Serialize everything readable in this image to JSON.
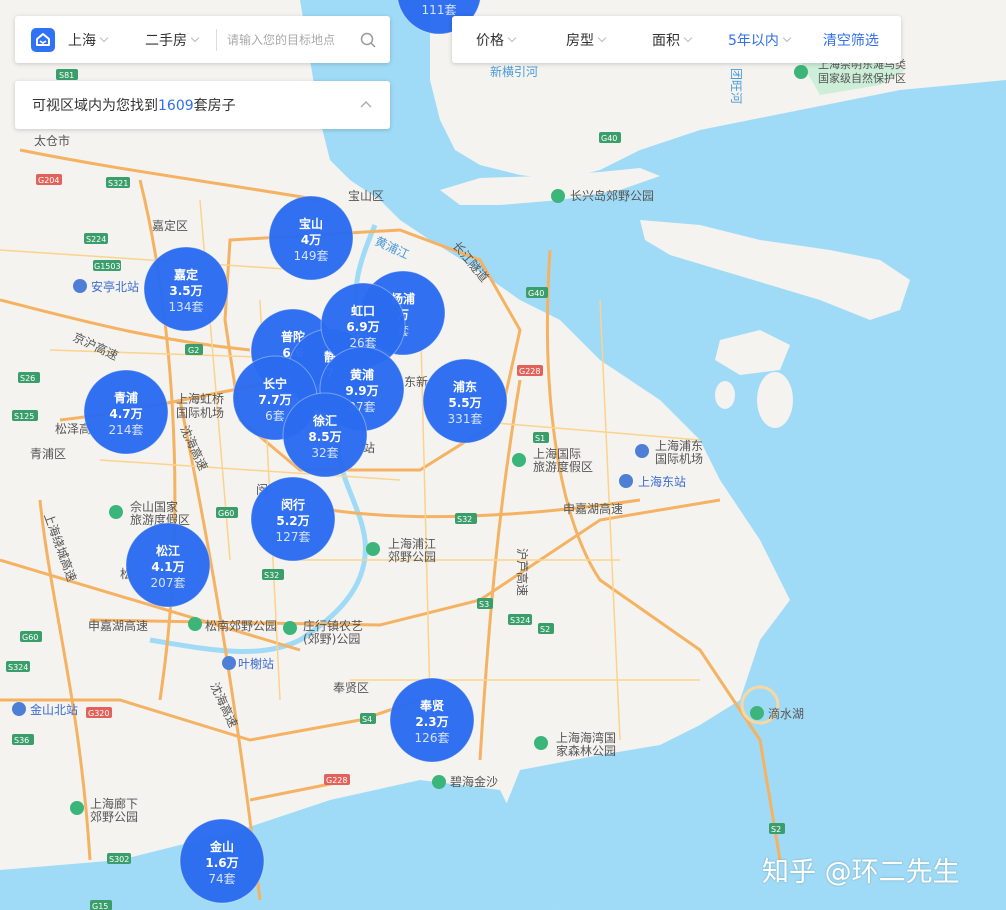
{
  "search": {
    "city": "上海",
    "house_type": "二手房",
    "placeholder": "请输入您的目标地点",
    "value": ""
  },
  "filters": {
    "price": "价格",
    "layout": "房型",
    "area": "面积",
    "years": "5年以内",
    "clear": "清空筛选"
  },
  "result": {
    "prefix": "可视区域内为您找到",
    "count": "1609",
    "suffix": "套房子"
  },
  "colors": {
    "accent": "#3072f6",
    "marker": "#2a6bf0",
    "water": "#9fdbf6",
    "land": "#f4f3ef",
    "highway": "#f5b262"
  },
  "districts": [
    {
      "name": "宝山",
      "price": "4万",
      "count": "149套"
    },
    {
      "name": "嘉定",
      "price": "3.5万",
      "count": "134套"
    },
    {
      "name": "杨浦",
      "price": "万",
      "count": "套"
    },
    {
      "name": "普陀",
      "price": "6.6",
      "count": ""
    },
    {
      "name": "静",
      "price": "7",
      "count": ""
    },
    {
      "name": "虹口",
      "price": "6.9万",
      "count": "26套"
    },
    {
      "name": "黄浦",
      "price": "9.9万",
      "count": "27套"
    },
    {
      "name": "青浦",
      "price": "4.7万",
      "count": "214套"
    },
    {
      "name": "长宁",
      "price": "7.7万",
      "count": "6套"
    },
    {
      "name": "徐汇",
      "price": "8.5万",
      "count": "32套"
    },
    {
      "name": "浦东",
      "price": "5.5万",
      "count": "331套"
    },
    {
      "name": "闵行",
      "price": "5.2万",
      "count": "127套"
    },
    {
      "name": "松江",
      "price": "4.1万",
      "count": "207套"
    },
    {
      "name": "奉贤",
      "price": "2.3万",
      "count": "126套"
    },
    {
      "name": "金山",
      "price": "1.6万",
      "count": "74套"
    },
    {
      "name": "",
      "price": "",
      "count": "111套"
    }
  ],
  "places": [
    {
      "text": "太仓市"
    },
    {
      "text": "宝山区"
    },
    {
      "text": "嘉定区"
    },
    {
      "text": "安亭北站"
    },
    {
      "text": "京沪高速"
    },
    {
      "text": "上海虹桥"
    },
    {
      "text": "国际机场"
    },
    {
      "text": "松泽高"
    },
    {
      "text": "青浦区"
    },
    {
      "text": "沈海高速"
    },
    {
      "text": "佘山国家"
    },
    {
      "text": "旅游度假区"
    },
    {
      "text": "上海绕城高速"
    },
    {
      "text": "申嘉湖高速"
    },
    {
      "text": "松南郊野公园"
    },
    {
      "text": "庄行镇农艺"
    },
    {
      "text": "(郊野)公园"
    },
    {
      "text": "叶榭站"
    },
    {
      "text": "沈海高速"
    },
    {
      "text": "奉贤区"
    },
    {
      "text": "金山北站"
    },
    {
      "text": "上海廊下"
    },
    {
      "text": "郊野公园"
    },
    {
      "text": "上海浦江"
    },
    {
      "text": "郊野公园"
    },
    {
      "text": "上海国际"
    },
    {
      "text": "旅游度假区"
    },
    {
      "text": "申嘉湖高速"
    },
    {
      "text": "沪芦高速"
    },
    {
      "text": "上海浦东"
    },
    {
      "text": "国际机场"
    },
    {
      "text": "上海东站"
    },
    {
      "text": "长兴岛郊野公园"
    },
    {
      "text": "黄浦江"
    },
    {
      "text": "长江隧道"
    },
    {
      "text": "上海崇明东滩鸟类"
    },
    {
      "text": "国家级自然保护区"
    },
    {
      "text": "新横引河"
    },
    {
      "text": "团旺河"
    },
    {
      "text": "滴水湖"
    },
    {
      "text": "上海海湾国"
    },
    {
      "text": "家森林公园"
    },
    {
      "text": "碧海金沙"
    },
    {
      "text": "东新"
    },
    {
      "text": "闵"
    },
    {
      "text": "松"
    },
    {
      "text": "站"
    }
  ],
  "road_shields": [
    {
      "text": "S81"
    },
    {
      "text": "G204"
    },
    {
      "text": "S321"
    },
    {
      "text": "S224"
    },
    {
      "text": "G1503"
    },
    {
      "text": "G2"
    },
    {
      "text": "S26"
    },
    {
      "text": "S125"
    },
    {
      "text": "G60"
    },
    {
      "text": "S32"
    },
    {
      "text": "G60"
    },
    {
      "text": "S324"
    },
    {
      "text": "G320"
    },
    {
      "text": "S36"
    },
    {
      "text": "S4"
    },
    {
      "text": "G228"
    },
    {
      "text": "S302"
    },
    {
      "text": "G15"
    },
    {
      "text": "S1"
    },
    {
      "text": "S32"
    },
    {
      "text": "S3"
    },
    {
      "text": "S324"
    },
    {
      "text": "S2"
    },
    {
      "text": "S2"
    },
    {
      "text": "G40"
    },
    {
      "text": "G40"
    },
    {
      "text": "G228"
    },
    {
      "text": "S4"
    }
  ],
  "watermark": "知乎 @环二先生"
}
